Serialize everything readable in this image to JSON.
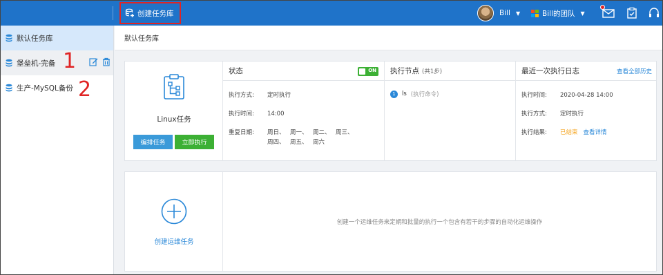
{
  "topbar": {
    "create_library_label": "创建任务库",
    "user_name": "Bill",
    "team_name": "Bill的团队"
  },
  "sidebar": {
    "items": [
      {
        "label": "默认任务库"
      },
      {
        "label": "堡垒机-完备"
      },
      {
        "label": "生产-MySQL备份"
      }
    ]
  },
  "annotations": {
    "one": "1",
    "two": "2"
  },
  "breadcrumb": "默认任务库",
  "task": {
    "name": "Linux任务",
    "edit_button": "编排任务",
    "run_button": "立即执行",
    "status_header": "状态",
    "toggle_label": "ON",
    "exec_mode_key": "执行方式:",
    "exec_mode_val": "定时执行",
    "exec_time_key": "执行时间:",
    "exec_time_val": "14:00",
    "repeat_key": "重复日期:",
    "repeat_days": [
      "周日、",
      "周一、",
      "周二、",
      "周三、",
      "周四、",
      "周五、",
      "周六"
    ],
    "nodes_header": "执行节点",
    "nodes_count": "(共1步)",
    "node_index": "1",
    "node_cmd": "ls",
    "node_type": "(执行命令)",
    "log_header": "最近一次执行日志",
    "log_history_link": "查看全部历史",
    "log_time_key": "执行时间:",
    "log_time_val": "2020-04-28 14:00",
    "log_mode_key": "执行方式:",
    "log_mode_val": "定时执行",
    "log_result_key": "执行结果:",
    "log_result_val": "已结束",
    "log_detail_link": "查看详情"
  },
  "create_task": {
    "label": "创建运维任务",
    "description": "创建一个运维任务来定期和批量的执行一个包含有若干的步骤的自动化运维操作"
  },
  "colors": {
    "topbar": "#1f73c9",
    "accent": "#2a88d8",
    "run_green": "#3cb034",
    "annotation_red": "#e02424",
    "finished_orange": "#f5a623"
  }
}
